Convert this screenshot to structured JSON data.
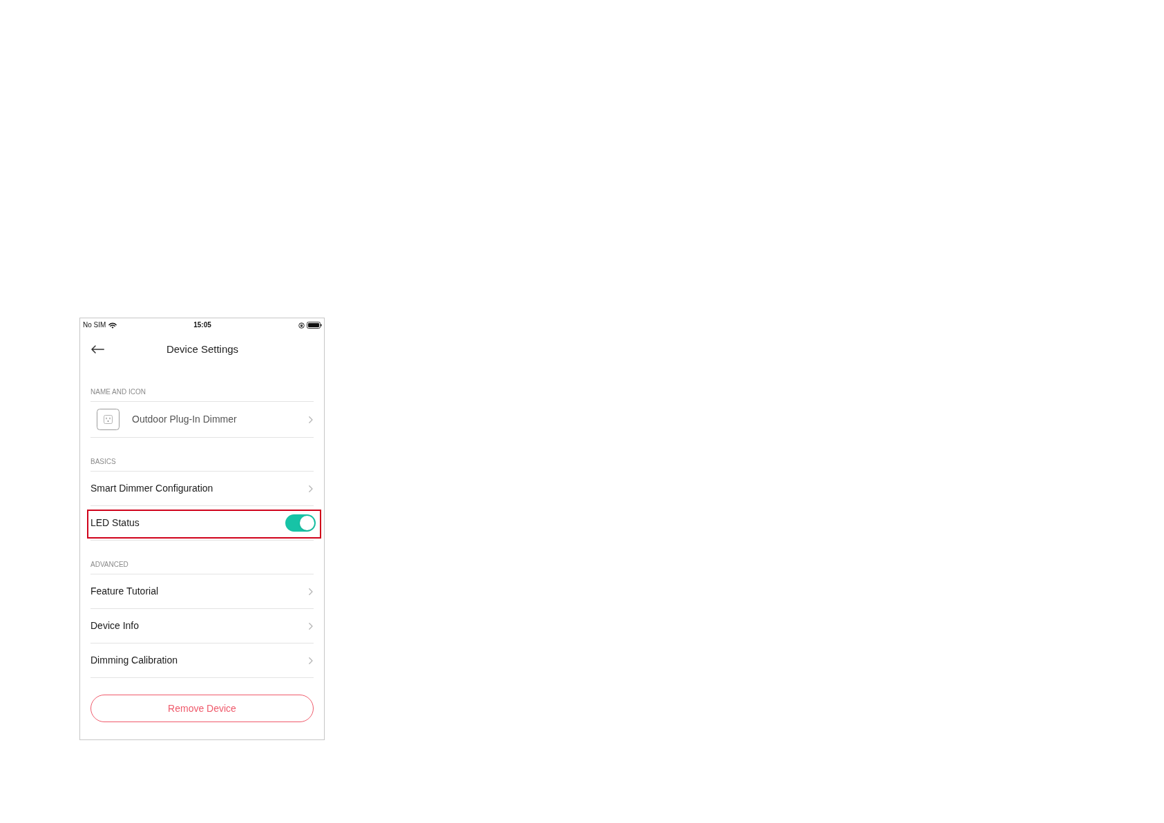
{
  "status_bar": {
    "carrier": "No SIM",
    "time": "15:05"
  },
  "header": {
    "title": "Device Settings"
  },
  "sections": [
    {
      "heading": "NAME AND ICON",
      "rows": [
        {
          "kind": "device",
          "label": "Outdoor Plug-In Dimmer",
          "highlighted": false
        }
      ]
    },
    {
      "heading": "BASICS",
      "rows": [
        {
          "kind": "link",
          "label": "Smart Dimmer Configuration",
          "highlighted": false
        },
        {
          "kind": "toggle",
          "label": "LED Status",
          "on": true,
          "highlighted": true
        }
      ]
    },
    {
      "heading": "ADVANCED",
      "rows": [
        {
          "kind": "link",
          "label": "Feature Tutorial",
          "highlighted": false
        },
        {
          "kind": "link",
          "label": "Device Info",
          "highlighted": false
        },
        {
          "kind": "link",
          "label": "Dimming Calibration",
          "highlighted": false
        }
      ]
    }
  ],
  "remove_button": {
    "label": "Remove Device"
  }
}
